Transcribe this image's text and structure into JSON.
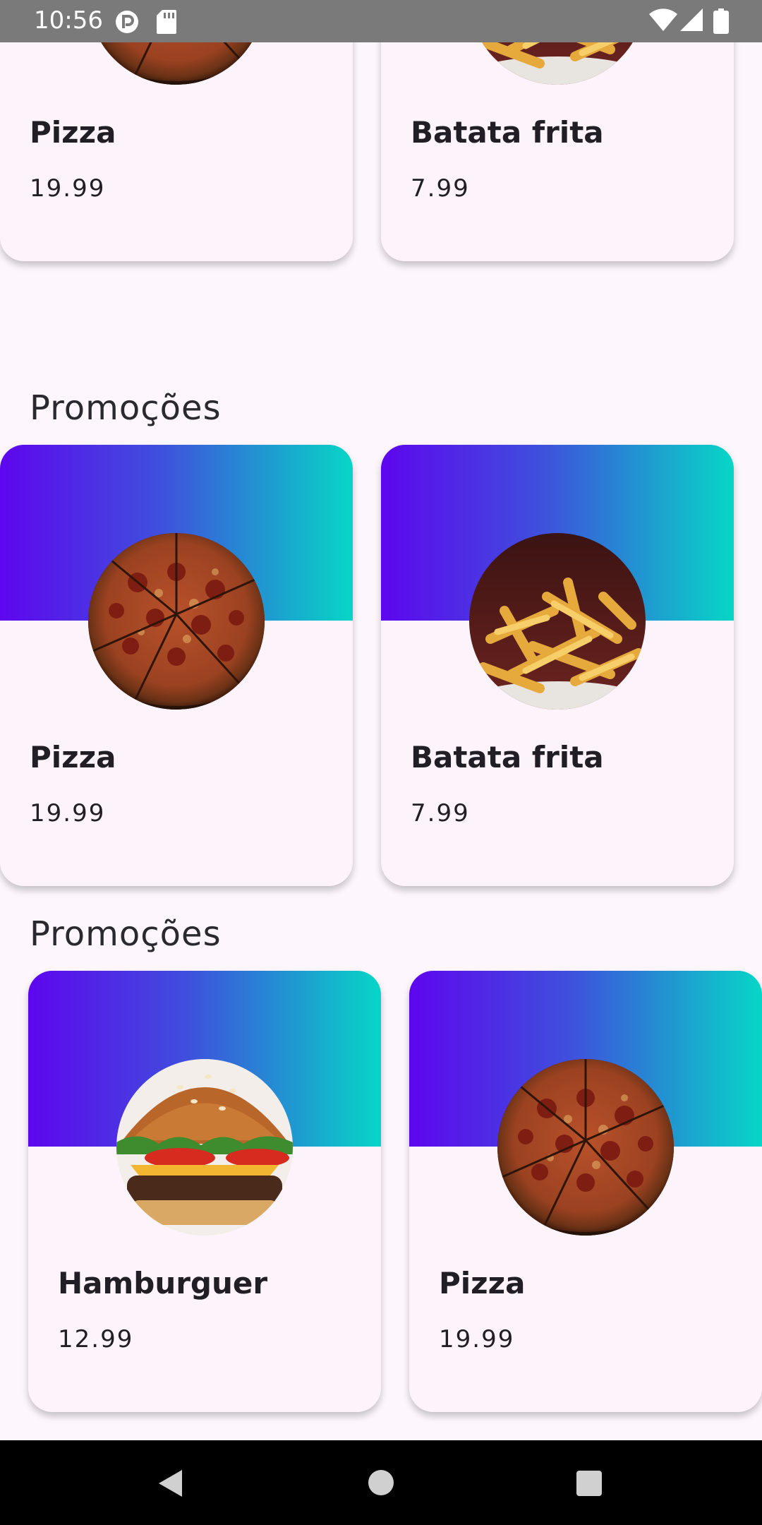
{
  "status_bar": {
    "time": "10:56"
  },
  "partial_row": [
    {
      "name": "Pizza",
      "price": "19.99",
      "image": "pizza"
    },
    {
      "name": "Batata frita",
      "price": "7.99",
      "image": "fries"
    }
  ],
  "sections": [
    {
      "title": "Promoções",
      "items": [
        {
          "name": "Pizza",
          "price": "19.99",
          "image": "pizza"
        },
        {
          "name": "Batata frita",
          "price": "7.99",
          "image": "fries"
        }
      ]
    },
    {
      "title": "Promoções",
      "items": [
        {
          "name": "Hamburguer",
          "price": "12.99",
          "image": "burger"
        },
        {
          "name": "Pizza",
          "price": "19.99",
          "image": "pizza"
        }
      ]
    }
  ],
  "colors": {
    "gradient_start": "#5E06EE",
    "gradient_end": "#06D6C6",
    "background": "#FDF7FD"
  }
}
